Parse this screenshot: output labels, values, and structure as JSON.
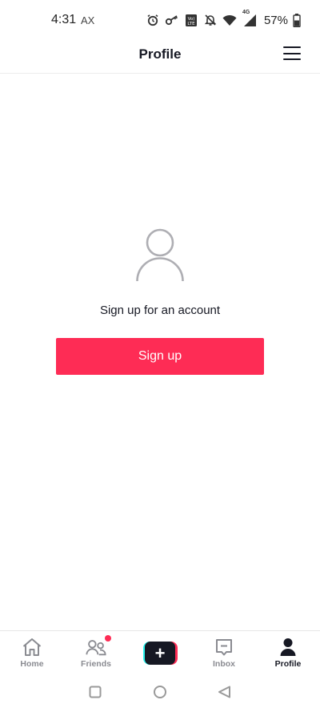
{
  "status_bar": {
    "time": "4:31",
    "carrier": "AX",
    "battery_percent": "57%",
    "network_label": "4G",
    "icons": [
      "alarm-icon",
      "key-icon",
      "volte-icon",
      "notifications-off-icon",
      "wifi-icon",
      "signal-icon",
      "battery-icon"
    ]
  },
  "header": {
    "title": "Profile",
    "menu_icon": "hamburger-menu-icon"
  },
  "empty_state": {
    "icon": "user-placeholder-icon",
    "prompt": "Sign up for an account",
    "signup_label": "Sign up"
  },
  "tab_bar": {
    "tabs": [
      {
        "label": "Home",
        "icon": "home-icon",
        "active": false
      },
      {
        "label": "Friends",
        "icon": "friends-icon",
        "active": false,
        "badge": true
      },
      {
        "label": "",
        "icon": "create-plus-icon",
        "active": false
      },
      {
        "label": "Inbox",
        "icon": "inbox-icon",
        "active": false
      },
      {
        "label": "Profile",
        "icon": "profile-icon",
        "active": true
      }
    ]
  },
  "nav_bar": {
    "buttons": [
      "recents-icon",
      "home-circle-icon",
      "back-icon"
    ]
  },
  "colors": {
    "accent": "#fe2c55",
    "cyan": "#25f4ee",
    "text_primary": "#161823",
    "text_secondary": "#8a8b91"
  }
}
